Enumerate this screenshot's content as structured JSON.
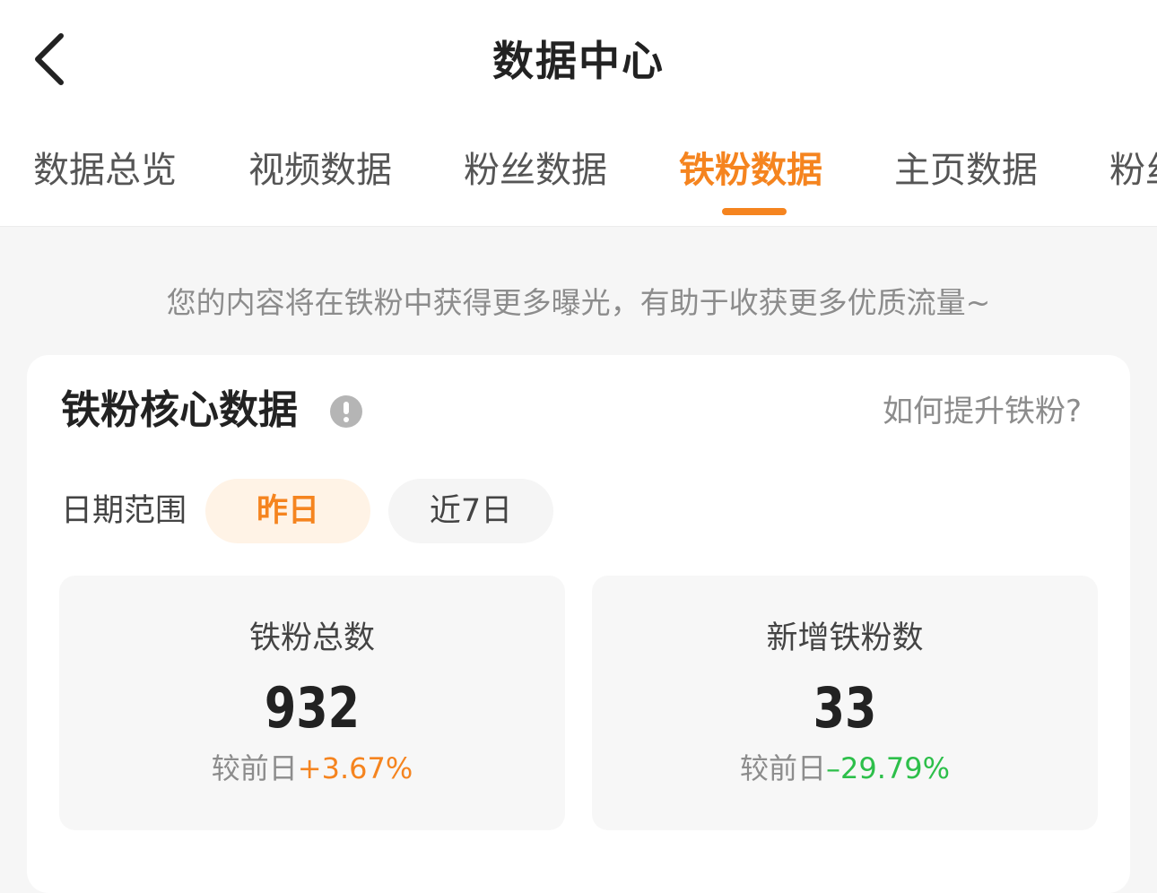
{
  "header": {
    "title": "数据中心",
    "back_icon": "chevron-left-icon"
  },
  "tabs": [
    {
      "label": "数据总览",
      "active": false
    },
    {
      "label": "视频数据",
      "active": false
    },
    {
      "label": "粉丝数据",
      "active": false
    },
    {
      "label": "铁粉数据",
      "active": true
    },
    {
      "label": "主页数据",
      "active": false
    },
    {
      "label": "粉丝",
      "active": false
    }
  ],
  "notice": "您的内容将在铁粉中获得更多曝光，有助于收获更多优质流量~",
  "card": {
    "title": "铁粉核心数据",
    "info_icon": "info-icon",
    "help_link": "如何提升铁粉?",
    "date_range": {
      "label": "日期范围",
      "options": [
        "昨日",
        "近7日"
      ],
      "selected": "昨日"
    },
    "stats": [
      {
        "label": "铁粉总数",
        "value": "932",
        "compare_label": "较前日",
        "change": "+3.67%",
        "trend": "up"
      },
      {
        "label": "新增铁粉数",
        "value": "33",
        "compare_label": "较前日",
        "change": "–29.79%",
        "trend": "down"
      }
    ]
  },
  "colors": {
    "accent": "#f5841f",
    "positive": "#f5841f",
    "negative": "#2dbf4a",
    "background": "#f6f6f6"
  }
}
